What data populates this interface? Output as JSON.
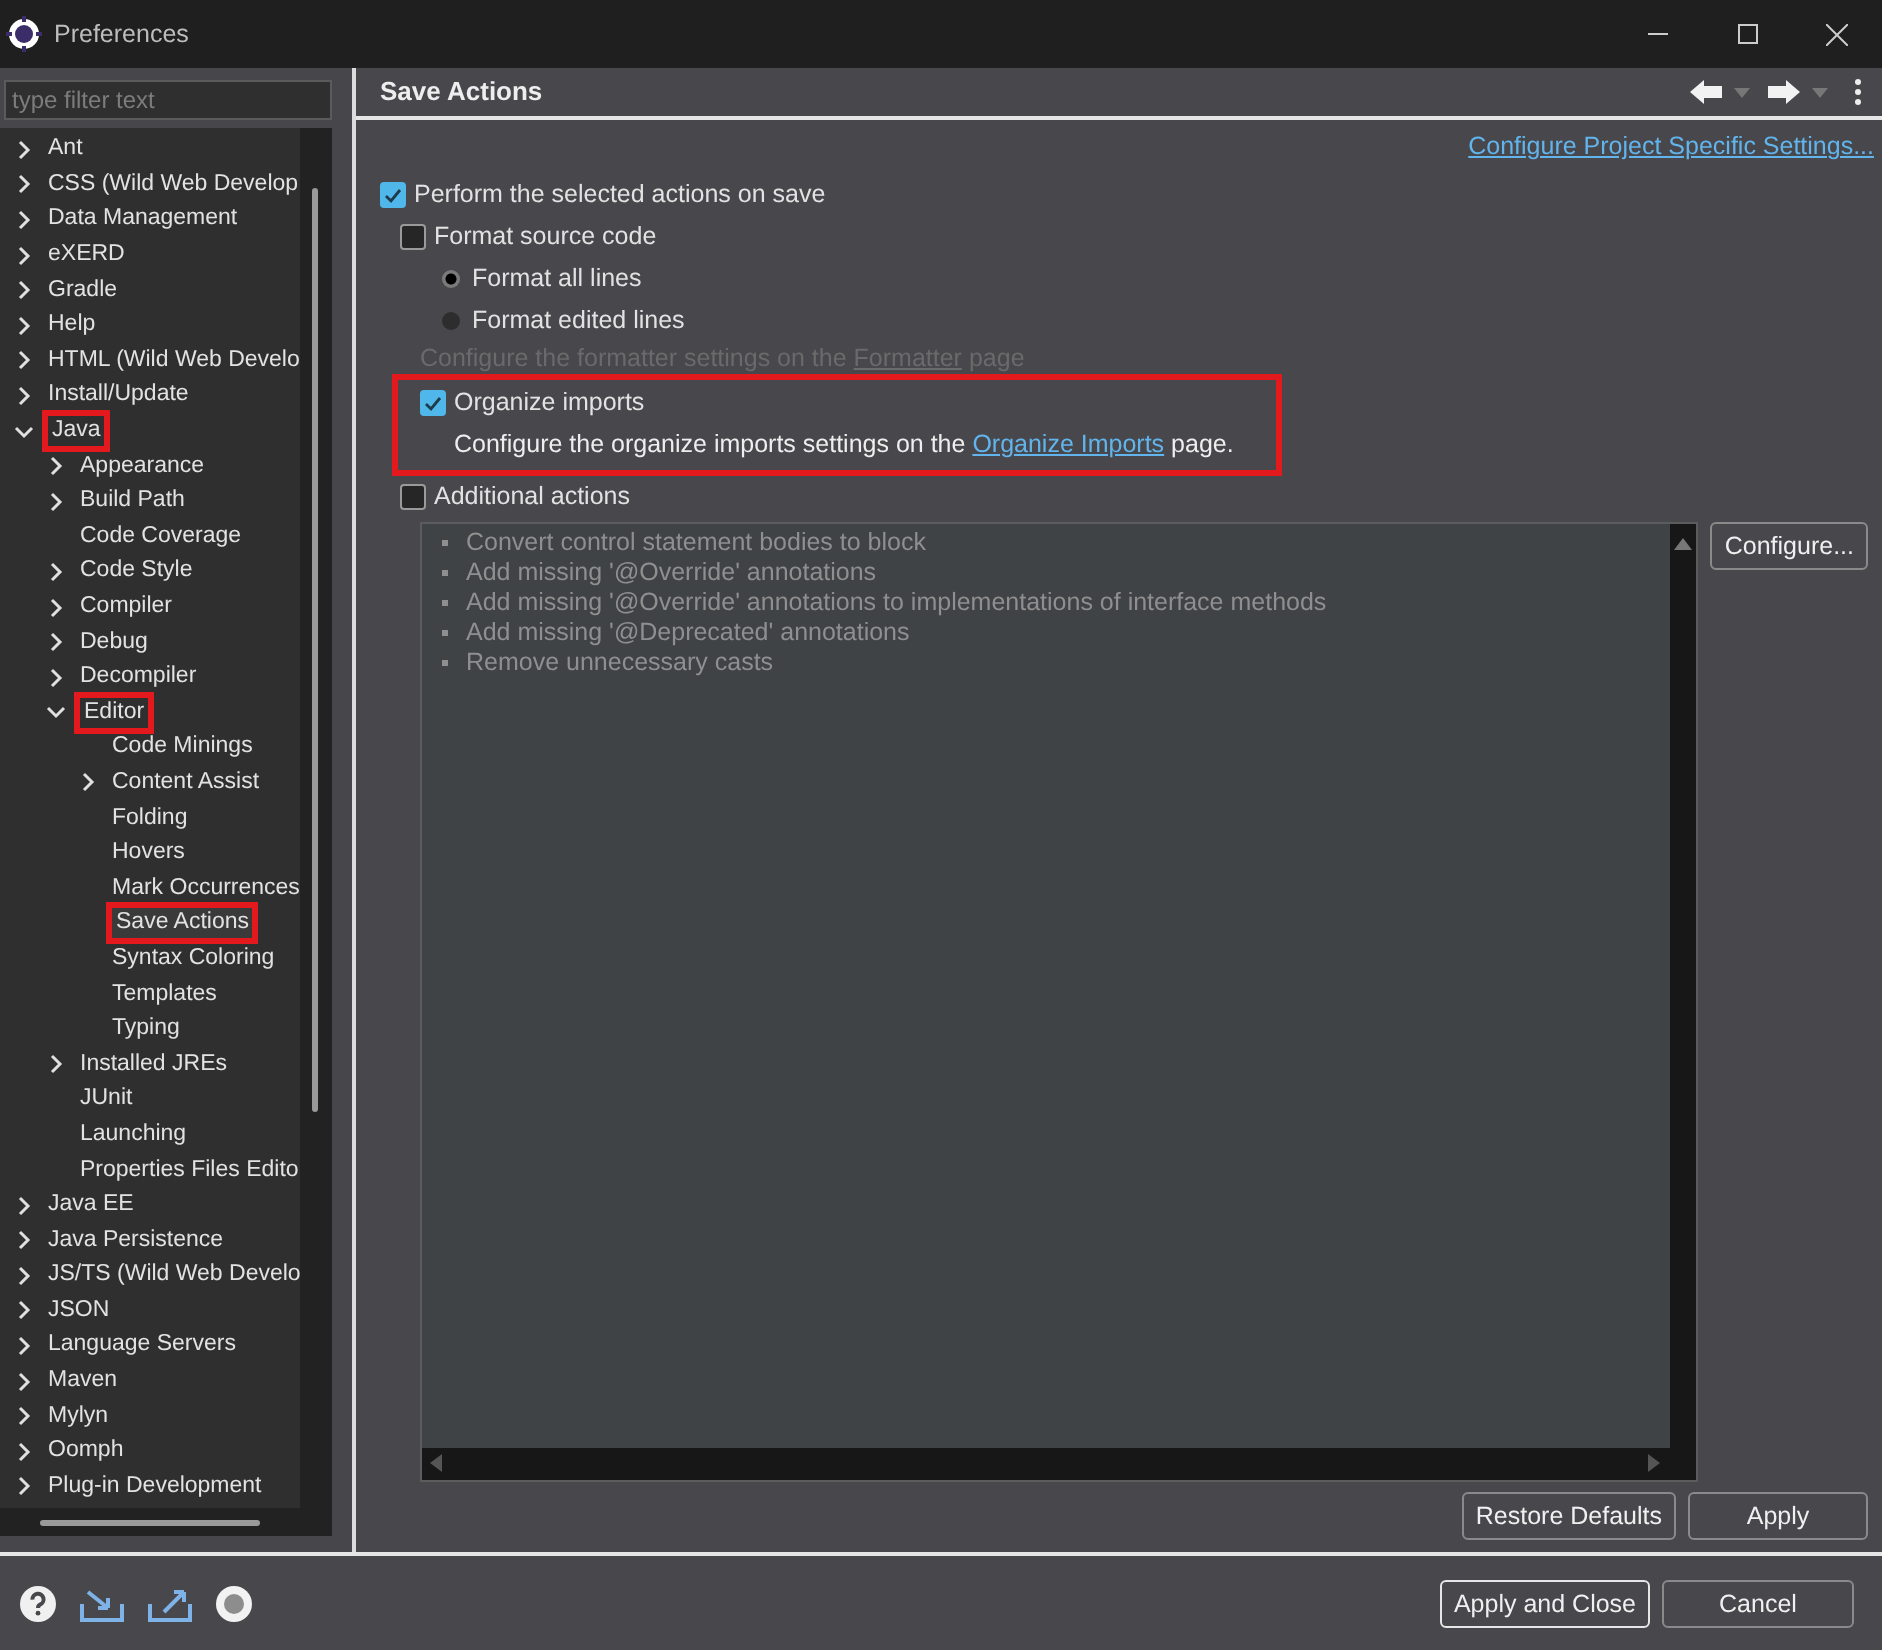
{
  "window": {
    "title": "Preferences"
  },
  "filter": {
    "placeholder": "type filter text"
  },
  "tree": [
    {
      "label": "Ant",
      "kind": "group",
      "expanded": false,
      "selected": false
    },
    {
      "label": "CSS (Wild Web Develop",
      "kind": "group",
      "expanded": false,
      "selected": false
    },
    {
      "label": "Data Management",
      "kind": "group",
      "expanded": false,
      "selected": false
    },
    {
      "label": "eXERD",
      "kind": "group",
      "expanded": false,
      "selected": false
    },
    {
      "label": "Gradle",
      "kind": "group",
      "expanded": false,
      "selected": false
    },
    {
      "label": "Help",
      "kind": "group",
      "expanded": false,
      "selected": false
    },
    {
      "label": "HTML (Wild Web Develo",
      "kind": "group",
      "expanded": false,
      "selected": false
    },
    {
      "label": "Install/Update",
      "kind": "group",
      "expanded": false,
      "selected": false
    },
    {
      "label": "Java",
      "kind": "group",
      "expanded": true,
      "selected": false,
      "marked": true,
      "children": [
        {
          "label": "Appearance",
          "kind": "group",
          "expanded": false,
          "selected": false
        },
        {
          "label": "Build Path",
          "kind": "group",
          "expanded": false,
          "selected": false
        },
        {
          "label": "Code Coverage",
          "kind": "page",
          "selected": false
        },
        {
          "label": "Code Style",
          "kind": "group",
          "expanded": false,
          "selected": false
        },
        {
          "label": "Compiler",
          "kind": "group",
          "expanded": false,
          "selected": false
        },
        {
          "label": "Debug",
          "kind": "group",
          "expanded": false,
          "selected": false
        },
        {
          "label": "Decompiler",
          "kind": "group",
          "expanded": false,
          "selected": false
        },
        {
          "label": "Editor",
          "kind": "group",
          "expanded": true,
          "selected": false,
          "marked": true,
          "children": [
            {
              "label": "Code Minings",
              "kind": "page",
              "selected": false
            },
            {
              "label": "Content Assist",
              "kind": "group",
              "expanded": false,
              "selected": false
            },
            {
              "label": "Folding",
              "kind": "page",
              "selected": false
            },
            {
              "label": "Hovers",
              "kind": "page",
              "selected": false
            },
            {
              "label": "Mark Occurrences",
              "kind": "page",
              "selected": false
            },
            {
              "label": "Save Actions",
              "kind": "page",
              "selected": true,
              "marked": true
            },
            {
              "label": "Syntax Coloring",
              "kind": "page",
              "selected": false
            },
            {
              "label": "Templates",
              "kind": "page",
              "selected": false
            },
            {
              "label": "Typing",
              "kind": "page",
              "selected": false
            }
          ]
        },
        {
          "label": "Installed JREs",
          "kind": "group",
          "expanded": false,
          "selected": false
        },
        {
          "label": "JUnit",
          "kind": "page",
          "selected": false
        },
        {
          "label": "Launching",
          "kind": "page",
          "selected": false
        },
        {
          "label": "Properties Files Edito",
          "kind": "page",
          "selected": false
        }
      ]
    },
    {
      "label": "Java EE",
      "kind": "group",
      "expanded": false,
      "selected": false
    },
    {
      "label": "Java Persistence",
      "kind": "group",
      "expanded": false,
      "selected": false
    },
    {
      "label": "JS/TS (Wild Web Develo",
      "kind": "group",
      "expanded": false,
      "selected": false
    },
    {
      "label": "JSON",
      "kind": "group",
      "expanded": false,
      "selected": false
    },
    {
      "label": "Language Servers",
      "kind": "group",
      "expanded": false,
      "selected": false
    },
    {
      "label": "Maven",
      "kind": "group",
      "expanded": false,
      "selected": false
    },
    {
      "label": "Mylyn",
      "kind": "group",
      "expanded": false,
      "selected": false
    },
    {
      "label": "Oomph",
      "kind": "group",
      "expanded": false,
      "selected": false
    },
    {
      "label": "Plug-in Development",
      "kind": "group",
      "expanded": false,
      "selected": false
    }
  ],
  "page": {
    "title": "Save Actions",
    "project_link": "Configure Project Specific Settings...",
    "perform": {
      "label": "Perform the selected actions on save",
      "checked": true
    },
    "sections": [
      {
        "kind": "format",
        "label": "Format source code",
        "checked": false,
        "radios": [
          {
            "label": "Format all lines",
            "selected": true
          },
          {
            "label": "Format edited lines",
            "selected": false
          }
        ],
        "note": {
          "before": "Configure the formatter settings on the ",
          "link": "Formatter",
          "after": " page",
          "disabled": true
        }
      },
      {
        "kind": "organize",
        "label": "Organize imports",
        "checked": true,
        "marked": true,
        "note": {
          "before": "Configure the organize imports settings on the ",
          "link": "Organize Imports",
          "after": " page.",
          "disabled": false
        }
      },
      {
        "kind": "additional",
        "label": "Additional actions",
        "checked": false,
        "actions": [
          "Convert control statement bodies to block",
          "Add missing '@Override' annotations",
          "Add missing '@Override' annotations to implementations of interface methods",
          "Add missing '@Deprecated' annotations",
          "Remove unnecessary casts"
        ],
        "configure": "Configure..."
      }
    ],
    "buttons": [
      "Restore Defaults",
      "Apply"
    ]
  },
  "footer_buttons": [
    {
      "label": "Apply and Close",
      "default": true
    },
    {
      "label": "Cancel",
      "default": false
    }
  ]
}
